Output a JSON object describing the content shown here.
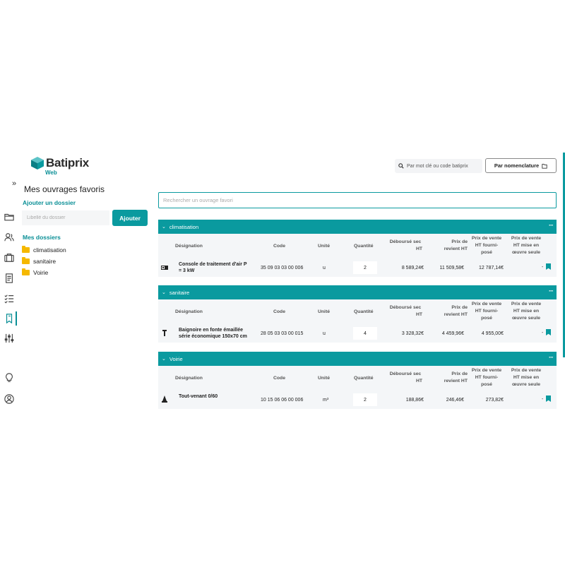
{
  "brand": {
    "name": "Batiprix",
    "sub": "Web",
    "accent": "#0a9a9f",
    "folder_color": "#f5b800"
  },
  "header": {
    "search_placeholder": "Par mot clé ou code batiprix",
    "nomenclature_label": "Par nomenclature"
  },
  "rail": {
    "expand_glyph": "»",
    "icons": [
      "folder-open-icon",
      "users-icon",
      "briefcase-icon",
      "document-icon",
      "checklist-icon",
      "bookmark-icon",
      "sliders-icon",
      "lightbulb-icon",
      "user-circle-icon"
    ]
  },
  "sidebar": {
    "page_title": "Mes ouvrages favoris",
    "add_folder_title": "Ajouter un dossier",
    "folder_input_placeholder": "Libellé du dossier",
    "add_button": "Ajouter",
    "my_folders_title": "Mes dossiers",
    "folders": [
      "climatisation",
      "sanitaire",
      "Voirie"
    ]
  },
  "main": {
    "search_placeholder": "Rechercher un ouvrage favori",
    "columns": {
      "designation": "Désignation",
      "code": "Code",
      "unit": "Unité",
      "quantity": "Quantité",
      "debourse": [
        "Déboursé sec",
        "HT"
      ],
      "prix_revient": [
        "Prix de",
        "revient HT"
      ],
      "prix_vente_fp": [
        "Prix de vente",
        "HT fourni-",
        "posé"
      ],
      "prix_vente_mo": [
        "Prix de vente",
        "HT mise en",
        "œuvre seule"
      ]
    },
    "groups": [
      {
        "name": "climatisation",
        "rows": [
          {
            "designation": [
              "Console de traitement d'air P",
              "= 3 kW"
            ],
            "code": "35 09 03 03 00 006",
            "unit": "u",
            "quantity": "2",
            "debourse": "8 589,24€",
            "prix_revient": "11 509,58€",
            "prix_vente_fp": "12 787,14€",
            "prix_vente_mo": "-",
            "icon": "hvac-unit-icon"
          }
        ]
      },
      {
        "name": "sanitaire",
        "rows": [
          {
            "designation": [
              "Baignoire en fonte émaillée",
              "série économique 150x70 cm"
            ],
            "code": "28 05 03 03 00 015",
            "unit": "u",
            "quantity": "4",
            "debourse": "3 328,32€",
            "prix_revient": "4 459,96€",
            "prix_vente_fp": "4 955,00€",
            "prix_vente_mo": "-",
            "icon": "faucet-icon"
          }
        ]
      },
      {
        "name": "Voirie",
        "rows": [
          {
            "designation": [
              "Tout-venant 0/60"
            ],
            "code": "10 15 06 06 00 006",
            "unit": "m³",
            "quantity": "2",
            "debourse": "188,86€",
            "prix_revient": "246,46€",
            "prix_vente_fp": "273,82€",
            "prix_vente_mo": "-",
            "icon": "road-cone-icon"
          }
        ]
      }
    ]
  }
}
